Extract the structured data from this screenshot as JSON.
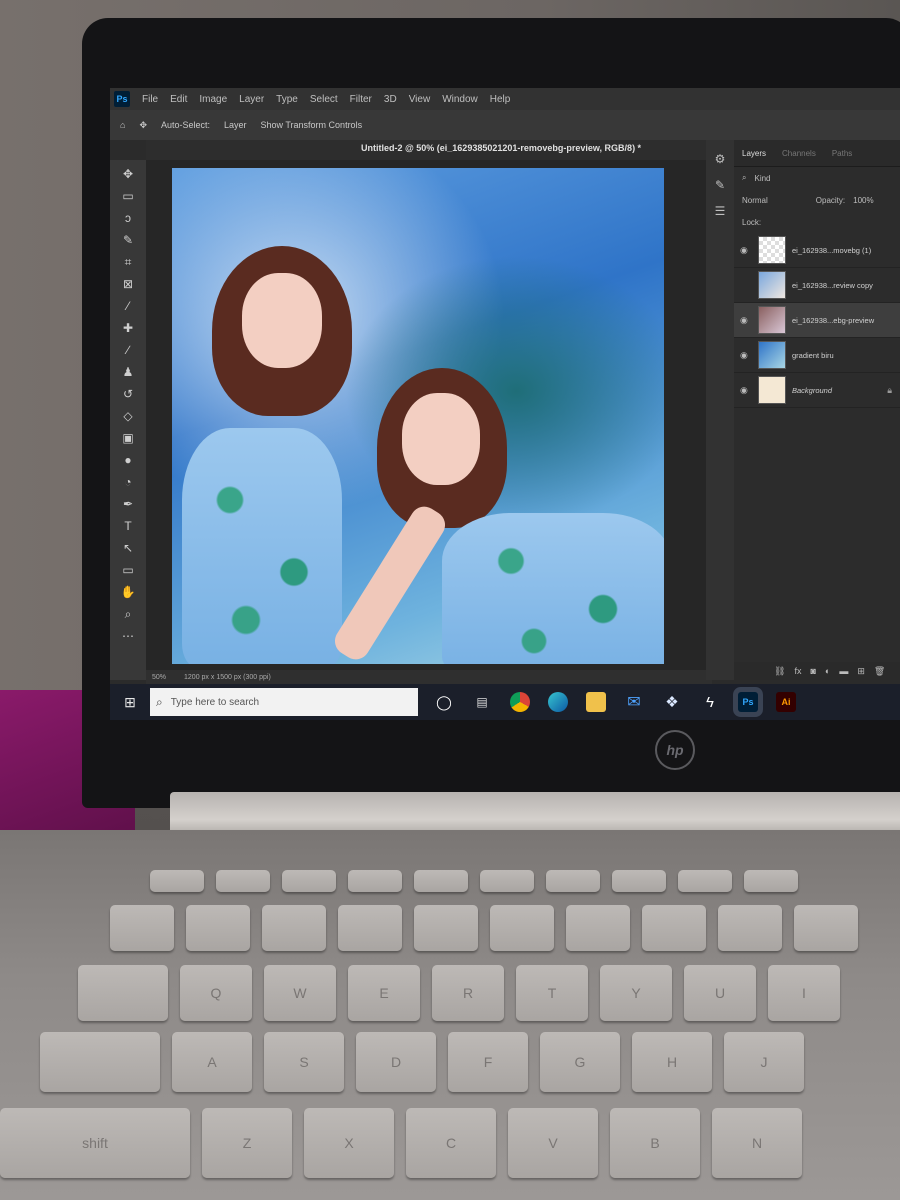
{
  "menu": {
    "app_badge": "Ps",
    "items": [
      "File",
      "Edit",
      "Image",
      "Layer",
      "Type",
      "Select",
      "Filter",
      "3D",
      "View",
      "Window",
      "Help"
    ]
  },
  "options_bar": {
    "auto_select": "Auto-Select:",
    "layer": "Layer",
    "transform": "Show Transform Controls"
  },
  "document_tab": "Untitled-2 @ 50% (ei_1629385021201-removebg-preview, RGB/8) *",
  "status_bar": {
    "zoom": "50%",
    "size": "1200 px x 1500 px (300 ppi)"
  },
  "layers_panel": {
    "tabs": [
      "Layers",
      "Channels",
      "Paths"
    ],
    "kind_label": "Kind",
    "blend_mode": "Normal",
    "opacity_label": "Opacity:",
    "opacity_value": "100%",
    "lock_label": "Lock:",
    "layers": [
      {
        "name": "ei_162938...movebg (1)",
        "selected": false
      },
      {
        "name": "ei_162938...review copy",
        "selected": false
      },
      {
        "name": "ei_162938...ebg-preview",
        "selected": true
      },
      {
        "name": "gradient biru",
        "selected": false
      },
      {
        "name": "Background",
        "selected": false,
        "locked": true
      }
    ]
  },
  "taskbar": {
    "search_placeholder": "Type here to search",
    "ps_label": "Ps",
    "ai_label": "Ai"
  },
  "keyboard": {
    "row1": [
      "Q",
      "W",
      "E",
      "R",
      "T",
      "Y",
      "U",
      "I"
    ],
    "row2": [
      "A",
      "S",
      "D",
      "F",
      "G",
      "H",
      "J"
    ],
    "row3": [
      "shift",
      "Z",
      "X",
      "C",
      "V",
      "B",
      "N"
    ]
  },
  "colors": {
    "photoshop_accent": "#31a8ff",
    "foreground_swatch": "#e05050",
    "background_swatch": "#f2b3a0"
  }
}
